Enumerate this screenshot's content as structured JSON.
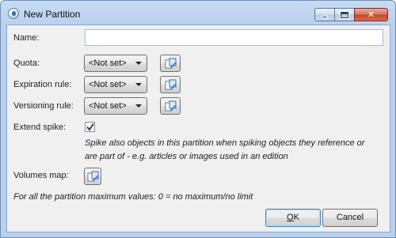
{
  "window": {
    "title": "New Partition"
  },
  "caption": {
    "close_glyph": "✕"
  },
  "form": {
    "name_label": "Name:",
    "name_value": "",
    "quota_label": "Quota:",
    "quota_value": "<Not set>",
    "expiration_label": "Expiration rule:",
    "expiration_value": "<Not set>",
    "versioning_label": "Versioning rule:",
    "versioning_value": "<Not set>",
    "extend_spike_label": "Extend spike:",
    "extend_spike_checked": true,
    "extend_spike_note_line1": "Spike also objects in this partition when spiking objects they reference or",
    "extend_spike_note_line2": "are part of - e.g. articles or images used in an edition",
    "volumes_map_label": "Volumes map:",
    "max_values_note": "For all the partition maximum values: 0 = no maximum/no limit"
  },
  "buttons": {
    "ok_label_accel": "O",
    "ok_label_rest": "K",
    "cancel_label": "Cancel"
  }
}
